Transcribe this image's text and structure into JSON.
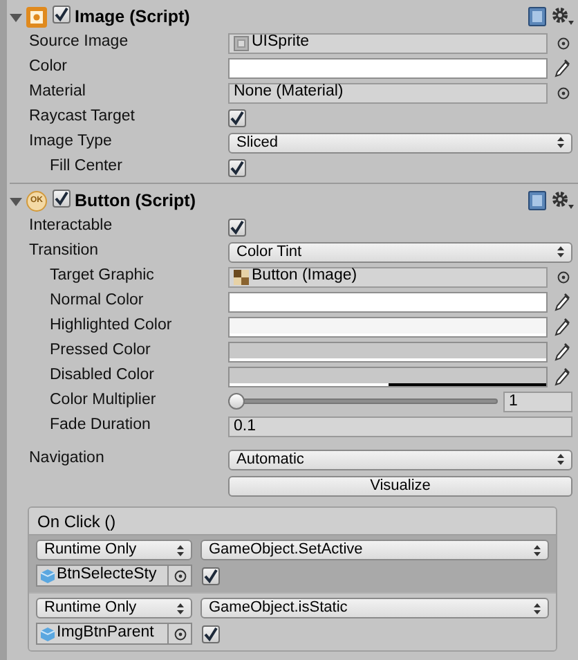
{
  "components": [
    {
      "title": "Image (Script)",
      "kind": "image",
      "enabled": true,
      "expanded": true,
      "properties": [
        {
          "kind": "sprite",
          "label": "Source Image",
          "value": "UISprite"
        },
        {
          "kind": "color",
          "label": "Color",
          "color": "#ffffff",
          "level": 1
        },
        {
          "kind": "asset",
          "label": "Material",
          "value": "None (Material)"
        },
        {
          "kind": "checkbox",
          "label": "Raycast Target",
          "checked": true
        },
        {
          "kind": "dropdown",
          "label": "Image Type",
          "value": "Sliced",
          "children": [
            {
              "kind": "checkbox",
              "label": "Fill Center",
              "checked": true
            }
          ]
        }
      ]
    },
    {
      "title": "Button (Script)",
      "kind": "button",
      "badge": "OK",
      "enabled": true,
      "expanded": true,
      "properties": [
        {
          "kind": "checkbox",
          "label": "Interactable",
          "checked": true
        },
        {
          "kind": "dropdown",
          "label": "Transition",
          "value": "Color Tint",
          "children": [
            {
              "kind": "graphic",
              "label": "Target Graphic",
              "value": "Button (Image)"
            },
            {
              "kind": "color",
              "label": "Normal Color",
              "color": "#ffffff",
              "level": 1
            },
            {
              "kind": "color",
              "label": "Highlighted Color",
              "color": "#f5f5f5",
              "level": 1
            },
            {
              "kind": "color",
              "label": "Pressed Color",
              "color": "#c8c8c8",
              "level": 1
            },
            {
              "kind": "color",
              "label": "Disabled Color",
              "color": "#c8c8c8",
              "level": 0.5
            },
            {
              "kind": "slider",
              "label": "Color Multiplier",
              "level": 0,
              "reading": "1"
            },
            {
              "kind": "text",
              "label": "Fade Duration",
              "value": "0.1"
            }
          ]
        }
      ],
      "navigation": {
        "label": "Navigation",
        "value": "Automatic"
      },
      "visualize_button": "Visualize",
      "on_click": {
        "title": "On Click ()",
        "entries": [
          {
            "mode": "Runtime Only",
            "function": "GameObject.SetActive",
            "object": "BtnSelecteSty",
            "checked": true,
            "selected": true
          },
          {
            "mode": "Runtime Only",
            "function": "GameObject.isStatic",
            "object": "ImgBtnParent",
            "checked": true,
            "selected": false
          }
        ]
      }
    }
  ]
}
